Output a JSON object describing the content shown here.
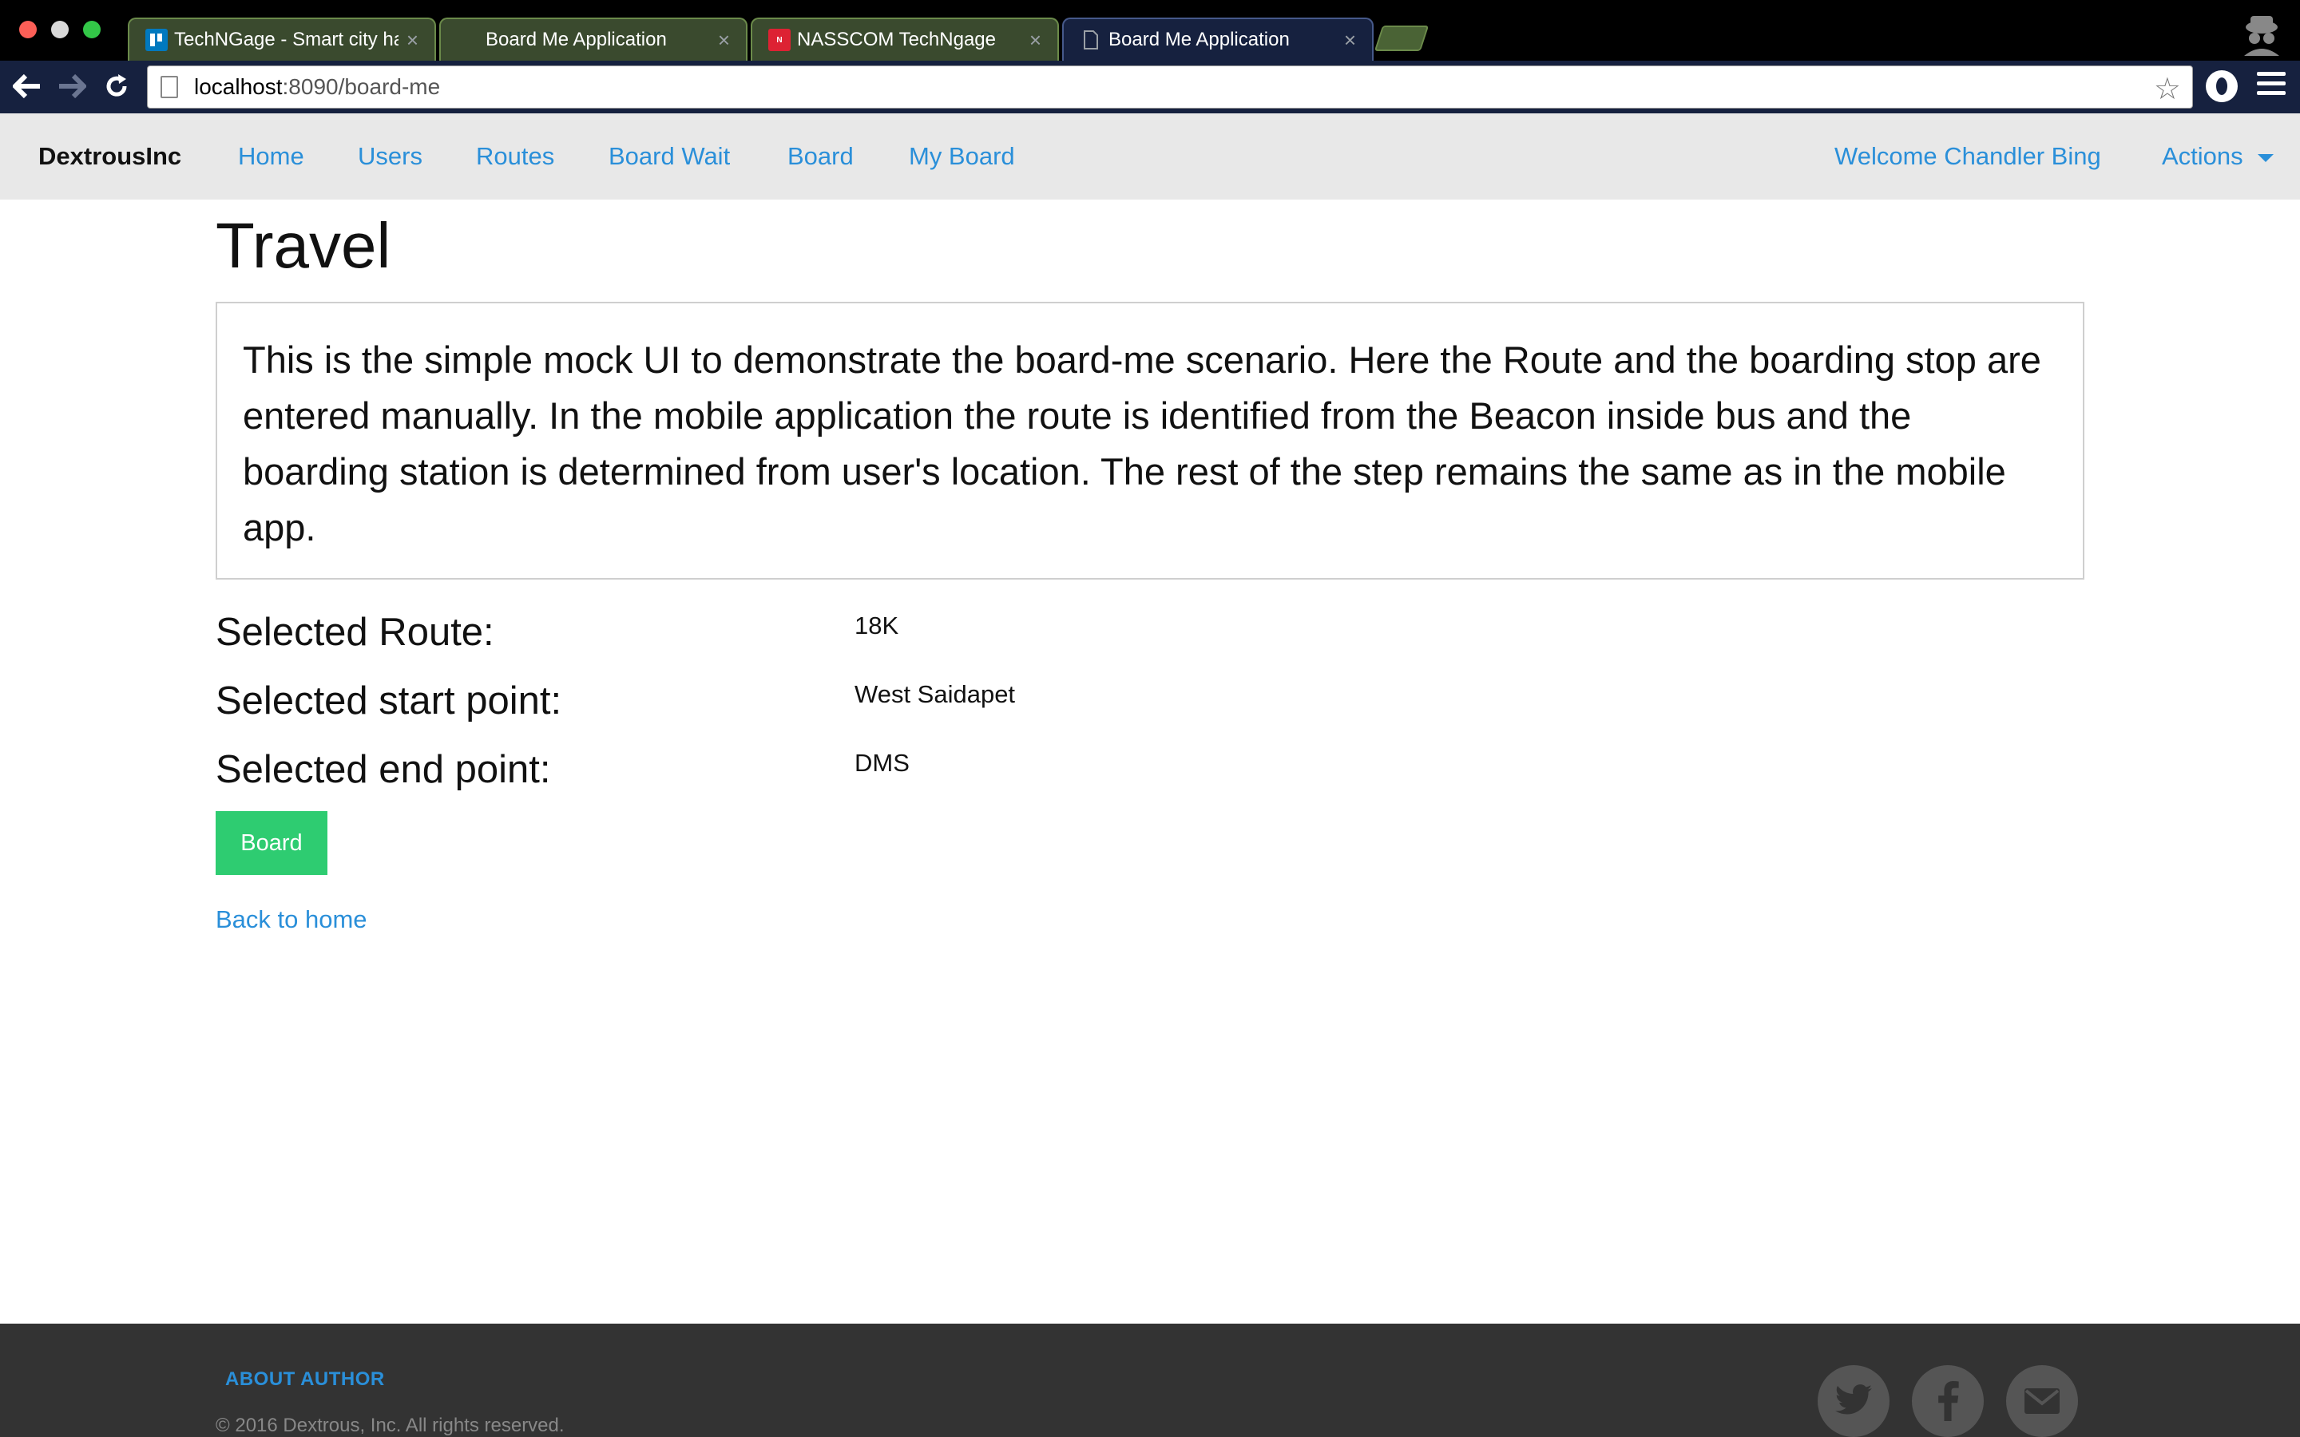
{
  "browser": {
    "tabs": [
      {
        "title": "TechNGage - Smart city ha",
        "favicon": "trello-icon"
      },
      {
        "title": "Board Me Application",
        "favicon": "document-icon"
      },
      {
        "title": "NASSCOM TechNgage",
        "favicon": "nasscom-icon"
      },
      {
        "title": "Board Me Application",
        "favicon": "document-icon",
        "active": true
      }
    ],
    "url": {
      "host": "localhost",
      "path": ":8090/board-me"
    }
  },
  "navbar": {
    "brand": "DextrousInc",
    "links": [
      "Home",
      "Users",
      "Routes",
      "Board Wait",
      "Board",
      "My Board"
    ],
    "welcome": "Welcome Chandler Bing",
    "actions": "Actions"
  },
  "main": {
    "title": "Travel",
    "description": "This is the simple mock UI to demonstrate the board-me scenario. Here the Route and the boarding stop are entered manually. In the mobile application the route is identified from the Beacon inside bus and the boarding station is determined from user's location. The rest of the step remains the same as in the mobile app.",
    "fields": [
      {
        "label": "Selected Route:",
        "value": "18K"
      },
      {
        "label": "Selected start point:",
        "value": "West Saidapet"
      },
      {
        "label": "Selected end point:",
        "value": "DMS"
      }
    ],
    "board_button": "Board",
    "back_link": "Back to home"
  },
  "footer": {
    "about": "ABOUT AUTHOR",
    "copyright": "© 2016 Dextrous, Inc. All rights reserved.",
    "social": [
      "twitter-icon",
      "facebook-icon",
      "email-icon"
    ]
  },
  "colors": {
    "link": "#2a8fd9",
    "button": "#2ecc71",
    "navbar_bg": "#e8e8e8",
    "footer_bg": "#333333"
  }
}
